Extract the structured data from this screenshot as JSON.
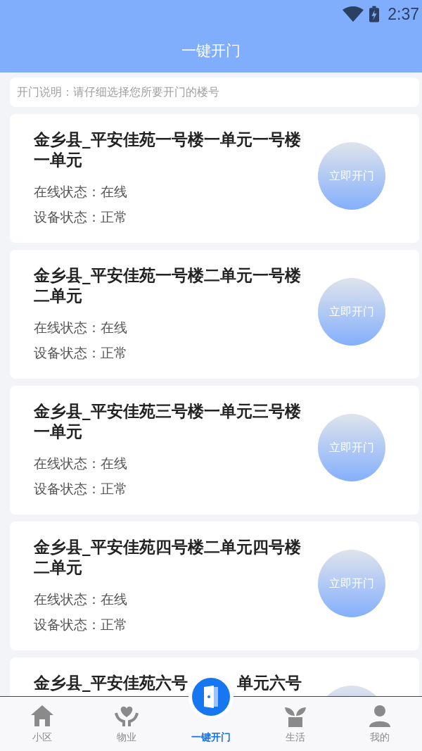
{
  "status_bar": {
    "time": "2:37"
  },
  "header": {
    "title": "一键开门"
  },
  "notice": "开门说明：请仔细选择您所要开门的楼号",
  "doors": [
    {
      "title": "金乡县_平安佳苑一号楼一单元一号楼一单元",
      "online_label": "在线状态：",
      "online": "在线",
      "device_label": "设备状态：",
      "device": "正常",
      "button": "立即开门"
    },
    {
      "title": "金乡县_平安佳苑一号楼二单元一号楼二单元",
      "online_label": "在线状态：",
      "online": "在线",
      "device_label": "设备状态：",
      "device": "正常",
      "button": "立即开门"
    },
    {
      "title": "金乡县_平安佳苑三号楼一单元三号楼一单元",
      "online_label": "在线状态：",
      "online": "在线",
      "device_label": "设备状态：",
      "device": "正常",
      "button": "立即开门"
    },
    {
      "title": "金乡县_平安佳苑四号楼二单元四号楼二单元",
      "online_label": "在线状态：",
      "online": "在线",
      "device_label": "设备状态：",
      "device": "正常",
      "button": "立即开门"
    },
    {
      "title_parts": [
        "金乡县_平安佳苑六号",
        "单元六号"
      ]
    }
  ],
  "nav": [
    {
      "label": "小区",
      "selected": false
    },
    {
      "label": "物业",
      "selected": false
    },
    {
      "label": "一键开门",
      "selected": true
    },
    {
      "label": "生活",
      "selected": false
    },
    {
      "label": "我的",
      "selected": false
    }
  ]
}
